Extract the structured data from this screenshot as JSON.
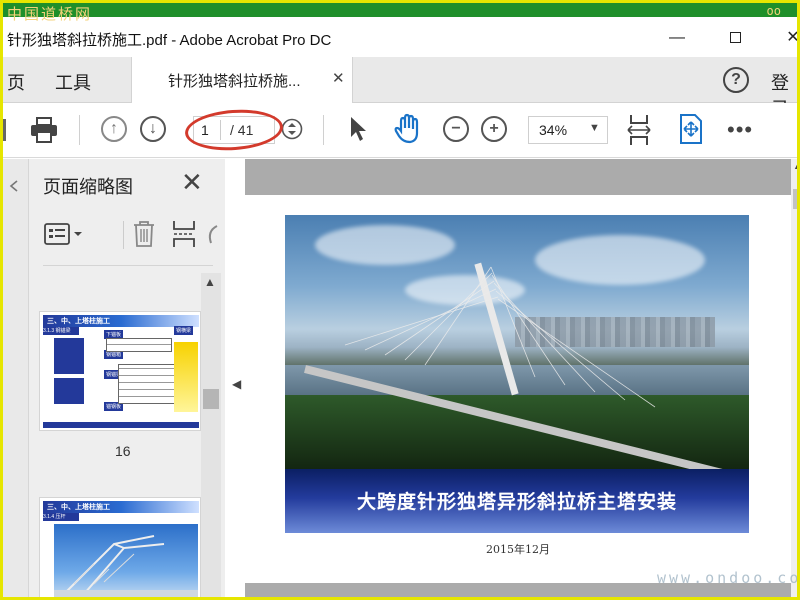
{
  "watermark": {
    "top_left": "中国道桥网",
    "top_right": "oo",
    "bottom_right": "www.ondoo.com"
  },
  "window": {
    "title": "针形独塔斜拉桥施工.pdf - Adobe Acrobat Pro DC",
    "minimize": "—",
    "close": "✕"
  },
  "tabs": {
    "home": "页",
    "tools": "工具",
    "document": "针形独塔斜拉桥施...",
    "document_close": "✕",
    "help": "?",
    "login": "登录"
  },
  "toolbar": {
    "current_page": "1",
    "total_pages": "/ 41",
    "zoom": "34%",
    "zoom_arrow": "▼",
    "more": "•••"
  },
  "thumbnails_panel": {
    "title": "页面缩略图",
    "close": "✕",
    "thumbnails": [
      {
        "page_number": "16",
        "header": "三、中、上塔柱施工",
        "sub": "3.1.3 钢锚梁"
      },
      {
        "page_number": "",
        "header": "三、中、上塔柱施工",
        "sub": "3.1.4 压杆"
      }
    ]
  },
  "document": {
    "banner_title": "大跨度针形独塔异形斜拉桥主塔安装",
    "date": "2015年12月"
  },
  "colors": {
    "accent_red": "#d33a2c",
    "blue_banner": "#233b9c",
    "toolbar_blue": "#1a73c8"
  }
}
